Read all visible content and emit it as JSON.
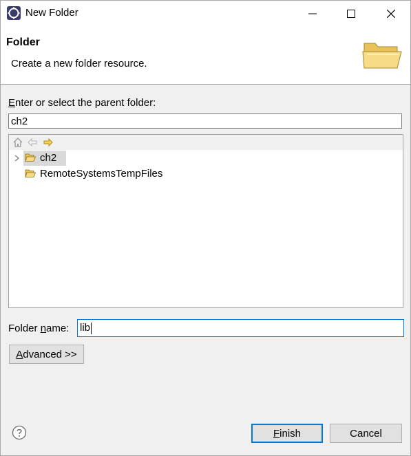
{
  "window": {
    "title": "New Folder"
  },
  "banner": {
    "title": "Folder",
    "description": "Create a new folder resource."
  },
  "parent_folder": {
    "label_mnemonic": "E",
    "label_rest": "nter or select the parent folder:",
    "value": "ch2"
  },
  "tree": {
    "items": [
      {
        "label": "ch2",
        "expandable": true,
        "selected": true
      },
      {
        "label": "RemoteSystemsTempFiles",
        "expandable": false,
        "selected": false
      }
    ]
  },
  "folder_name": {
    "label_before": "Folder ",
    "label_mnemonic": "n",
    "label_after": "ame:",
    "value": "lib"
  },
  "buttons": {
    "advanced_mnemonic": "A",
    "advanced_rest": "dvanced >>",
    "finish_mnemonic": "F",
    "finish_rest": "inish",
    "cancel": "Cancel"
  },
  "colors": {
    "focus_border": "#0078d7",
    "selection_bg": "#d9d9d9",
    "folder_yellow": "#f2c94c"
  }
}
